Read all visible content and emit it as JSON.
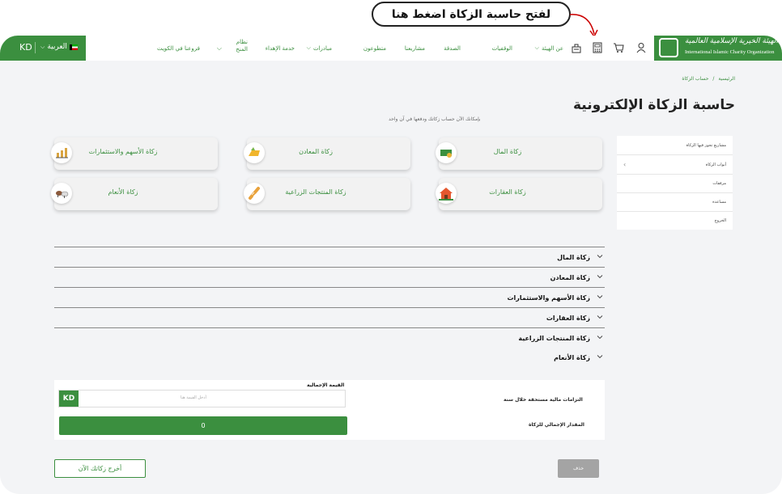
{
  "callout": {
    "text": "لفتح حاسبة الزكاة اضغط هنا"
  },
  "header": {
    "logo_ar": "الهيئة الخيرية الإسلامية العالمية",
    "logo_en": "International Islamic Charity Organization",
    "currency": "KD",
    "language": "العربية",
    "nav": {
      "about": "عن الهيئة",
      "endowments": "الوقفيات",
      "charity": "الصدقة",
      "projects": "مشاريعنا",
      "volunteers": "متطوعون",
      "initiatives": "مبادرات",
      "gifting": "خدمة الإهداء",
      "grants_l1": "نظام",
      "grants_l2": "المنح",
      "branches": "فروعنا في الكويت"
    },
    "icons": [
      "user-icon",
      "cart-icon",
      "calculator-icon",
      "donation-box-icon"
    ]
  },
  "breadcrumb": {
    "home": "الرئيسية",
    "sep": "/",
    "current": "حساب الزكاة"
  },
  "page": {
    "title": "حاسبة الزكاة الإلكترونية",
    "subtitle": "بإمكانك الآن حساب زكاتك ودفعها في آن واحد"
  },
  "cards": [
    {
      "label": "زكاة المال",
      "icon": "money-icon"
    },
    {
      "label": "زكاة المعادن",
      "icon": "gold-icon"
    },
    {
      "label": "زكاة الأسهم والاستثمارات",
      "icon": "stocks-icon"
    },
    {
      "label": "زكاة العقارات",
      "icon": "house-icon"
    },
    {
      "label": "زكاة المنتجات الزراعية",
      "icon": "wheat-icon"
    },
    {
      "label": "زكاة الأنعام",
      "icon": "livestock-icon"
    }
  ],
  "sidebar": [
    {
      "label": "مشاريع تجوز فيها الزكاة"
    },
    {
      "label": "أبواب الزكاة"
    },
    {
      "label": "مرفقات"
    },
    {
      "label": "مساعدة"
    },
    {
      "label": "الخروج"
    }
  ],
  "accordion": [
    {
      "label": "زكاة المال"
    },
    {
      "label": "زكاة المعادن"
    },
    {
      "label": "زكاة الأسهم والاستثمارات"
    },
    {
      "label": "زكاة العقارات"
    },
    {
      "label": "زكاة المنتجات الزراعية"
    },
    {
      "label": "زكاة الأنعام"
    }
  ],
  "form": {
    "total_label": "القيمة الإجمالية",
    "currency": "KD",
    "placeholder": "أدخل القيمة هنا",
    "obligations_label": "التزامات مالية مستحقة خلال سنة",
    "result_value": "0",
    "result_label": "المقدار الإجمالي للزكاة"
  },
  "buttons": {
    "pay": "أخرج زكاتك الآن",
    "delete": "حذف"
  },
  "colors": {
    "brand_green": "#3b8f3f",
    "button_grey": "#a4a4a4"
  }
}
